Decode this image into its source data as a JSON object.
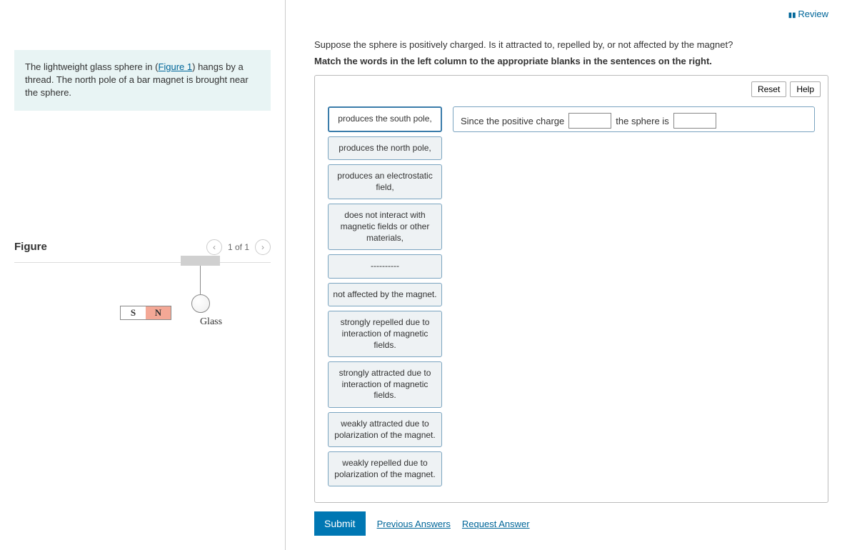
{
  "topbar": {
    "review": "Review"
  },
  "left": {
    "info_prefix": "The lightweight glass sphere in (",
    "info_link": "Figure 1",
    "info_suffix": ") hangs by a thread. The north pole of a bar magnet is brought near the sphere.",
    "figure_title": "Figure",
    "figure_counter": "1 of 1",
    "magnet_s": "S",
    "magnet_n": "N",
    "glass_label": "Glass"
  },
  "prompt": {
    "line1": "Suppose the sphere is positively charged. Is it attracted to, repelled by, or not affected by the magnet?",
    "line2": "Match the words in the left column to the appropriate blanks in the sentences on the right."
  },
  "tools": {
    "reset": "Reset",
    "help": "Help"
  },
  "words": [
    "produces the south pole,",
    "produces the north pole,",
    "produces an electrostatic field,",
    "does not interact with magnetic fields or other materials,",
    "----------",
    "not affected by the magnet.",
    "strongly repelled due to interaction of magnetic fields.",
    "strongly attracted due to interaction of magnetic fields.",
    "weakly attracted due to polarization of the magnet.",
    "weakly repelled due to polarization of the magnet."
  ],
  "sentence": {
    "part1": "Since the positive charge",
    "part2": "the sphere is"
  },
  "actions": {
    "submit": "Submit",
    "previous": "Previous Answers",
    "request": "Request Answer"
  }
}
